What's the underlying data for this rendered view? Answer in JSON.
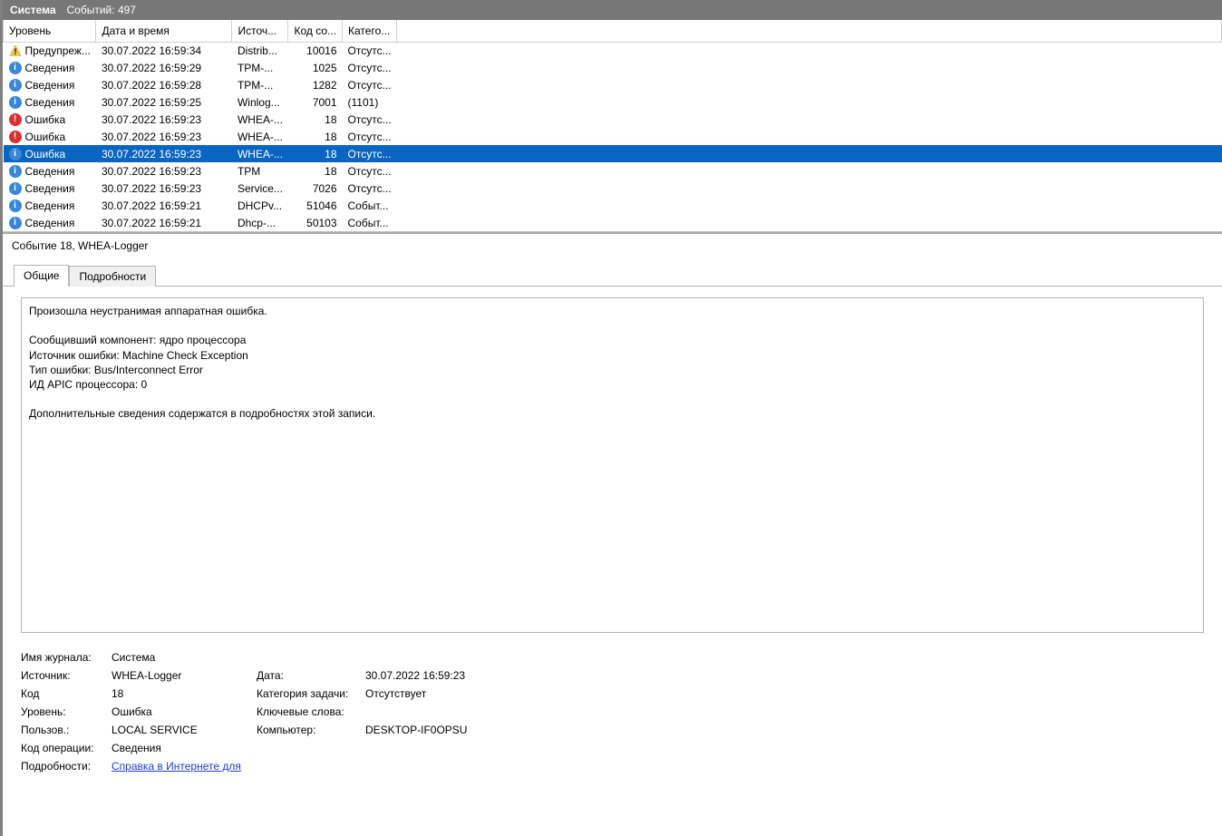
{
  "titlebar": {
    "log_name": "Система",
    "events_label": "Событий:",
    "events_count": "497"
  },
  "columns": {
    "level": "Уровень",
    "datetime": "Дата и время",
    "source": "Источ...",
    "code": "Код со...",
    "category": "Катего..."
  },
  "rows": [
    {
      "icon": "warn",
      "level": "Предупреж...",
      "dt": "30.07.2022 16:59:34",
      "src": "Distrib...",
      "code": "10016",
      "cat": "Отсутс..."
    },
    {
      "icon": "info",
      "level": "Сведения",
      "dt": "30.07.2022 16:59:29",
      "src": "TPM-...",
      "code": "1025",
      "cat": "Отсутс..."
    },
    {
      "icon": "info",
      "level": "Сведения",
      "dt": "30.07.2022 16:59:28",
      "src": "TPM-...",
      "code": "1282",
      "cat": "Отсутс..."
    },
    {
      "icon": "info",
      "level": "Сведения",
      "dt": "30.07.2022 16:59:25",
      "src": "Winlog...",
      "code": "7001",
      "cat": "(1101)"
    },
    {
      "icon": "error",
      "level": "Ошибка",
      "dt": "30.07.2022 16:59:23",
      "src": "WHEA-...",
      "code": "18",
      "cat": "Отсутс..."
    },
    {
      "icon": "error",
      "level": "Ошибка",
      "dt": "30.07.2022 16:59:23",
      "src": "WHEA-...",
      "code": "18",
      "cat": "Отсутс..."
    },
    {
      "icon": "info",
      "level": "Ошибка",
      "dt": "30.07.2022 16:59:23",
      "src": "WHEA-...",
      "code": "18",
      "cat": "Отсутс...",
      "selected": true
    },
    {
      "icon": "info",
      "level": "Сведения",
      "dt": "30.07.2022 16:59:23",
      "src": "TPM",
      "code": "18",
      "cat": "Отсутс..."
    },
    {
      "icon": "info",
      "level": "Сведения",
      "dt": "30.07.2022 16:59:23",
      "src": "Service...",
      "code": "7026",
      "cat": "Отсутс..."
    },
    {
      "icon": "info",
      "level": "Сведения",
      "dt": "30.07.2022 16:59:21",
      "src": "DHCPv...",
      "code": "51046",
      "cat": "Событ..."
    },
    {
      "icon": "info",
      "level": "Сведения",
      "dt": "30.07.2022 16:59:21",
      "src": "Dhcp-...",
      "code": "50103",
      "cat": "Событ..."
    }
  ],
  "detail": {
    "header": "Событие 18, WHEA-Logger",
    "tabs": {
      "general": "Общие",
      "details": "Подробности"
    },
    "message": "Произошла неустранимая аппаратная ошибка.\n\nСообщивший компонент: ядро процессора\nИсточник ошибки: Machine Check Exception\nТип ошибки: Bus/Interconnect Error\nИД APIC процессора: 0\n\nДополнительные сведения содержатся в подробностях этой записи.",
    "props": {
      "log_label": "Имя журнала:",
      "log_value": "Система",
      "source_label": "Источник:",
      "source_value": "WHEA-Logger",
      "date_label": "Дата:",
      "date_value": "30.07.2022 16:59:23",
      "code_label": "Код",
      "code_value": "18",
      "taskcat_label": "Категория задачи:",
      "taskcat_value": "Отсутствует",
      "level_label": "Уровень:",
      "level_value": "Ошибка",
      "keywords_label": "Ключевые слова:",
      "keywords_value": "",
      "user_label": "Пользов.:",
      "user_value": "LOCAL SERVICE",
      "computer_label": "Компьютер:",
      "computer_value": "DESKTOP-IF0OPSU",
      "opcode_label": "Код операции:",
      "opcode_value": "Сведения",
      "moreinfo_label": "Подробности:",
      "moreinfo_link": "Справка в Интернете для "
    }
  }
}
